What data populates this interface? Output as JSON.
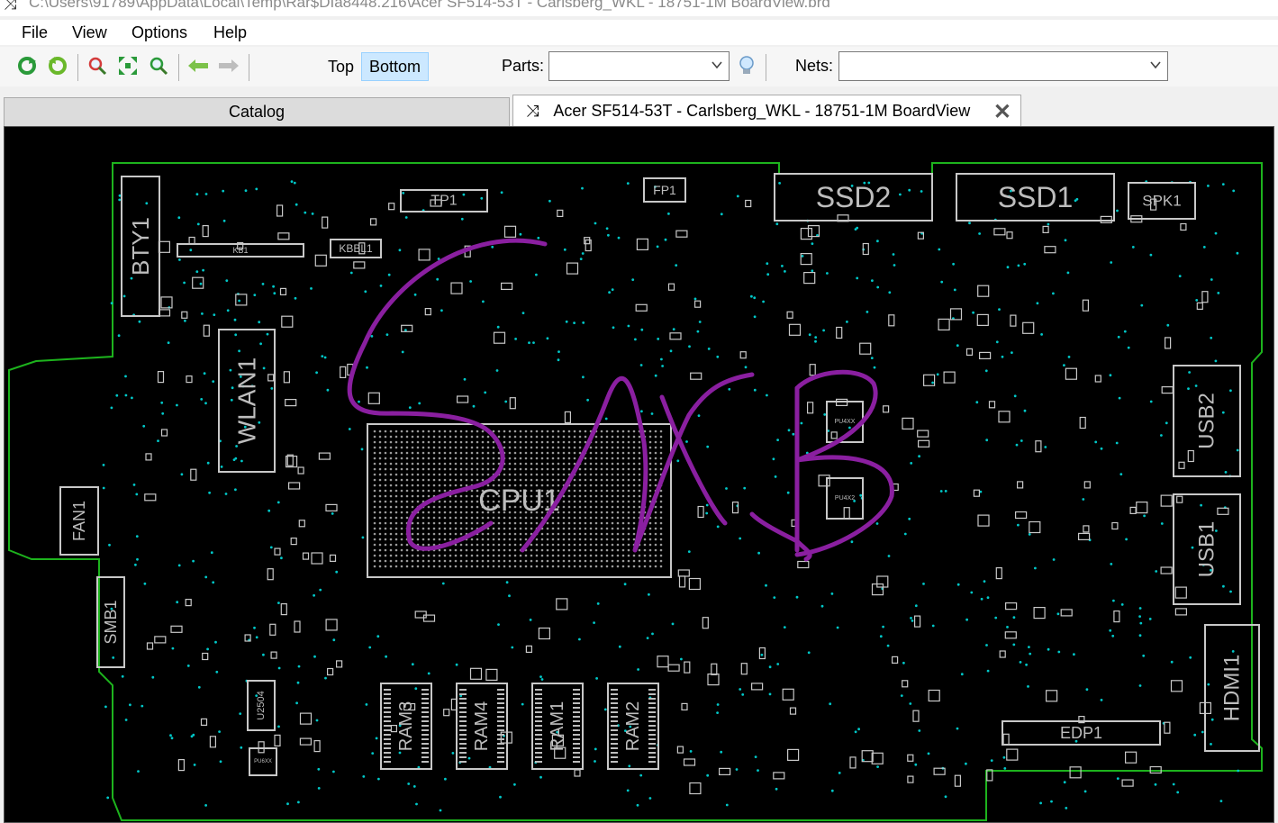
{
  "window": {
    "title": "C:\\Users\\91789\\AppData\\Local\\Temp\\Rar$DIa8448.216\\Acer SF514-53T - Carlsberg_WKL - 18751-1M BoardView.brd",
    "icon": "boardview-app-icon"
  },
  "menu": {
    "file": "File",
    "view": "View",
    "options": "Options",
    "help": "Help"
  },
  "toolbar": {
    "icons": [
      "rotate-cw-icon",
      "rotate-ccw-icon",
      "zoom-in-icon",
      "fit-icon",
      "zoom-out-icon",
      "back-arrow-icon",
      "forward-arrow-icon"
    ],
    "top_label": "Top",
    "bottom_label": "Bottom",
    "active_side": "Bottom",
    "parts_label": "Parts:",
    "parts_value": "",
    "nets_label": "Nets:",
    "nets_value": "",
    "bulb_icon": "lightbulb-icon"
  },
  "tabs": {
    "catalog": "Catalog",
    "board": "Acer SF514-53T - Carlsberg_WKL - 18751-1M BoardView"
  },
  "board": {
    "outline_color": "#1db31d",
    "part_color": "#c8c8c8",
    "pad_color": "#00c8c8",
    "annotation_color": "#8a1fa0",
    "labels": {
      "bty1": "BTY1",
      "kb1": "KB1",
      "tp1": "TP1",
      "fp1": "FP1",
      "kbbl1": "KBBL1",
      "ssd2": "SSD2",
      "ssd1": "SSD1",
      "spk1": "SPK1",
      "wlan1": "WLAN1",
      "cpu1": "CPU1",
      "fan1": "FAN1",
      "smb1": "SMB1",
      "usb2": "USB2",
      "usb1": "USB1",
      "hdmi1": "HDMI1",
      "edp1": "EDP1",
      "ram3": "RAM3",
      "ram4": "RAM4",
      "ram1": "RAM1",
      "ram2": "RAM2",
      "u2504": "U2504",
      "pu4xx": "PU4XX",
      "pu4x2": "PU4X2",
      "pu6xx": "PU6XX"
    }
  }
}
